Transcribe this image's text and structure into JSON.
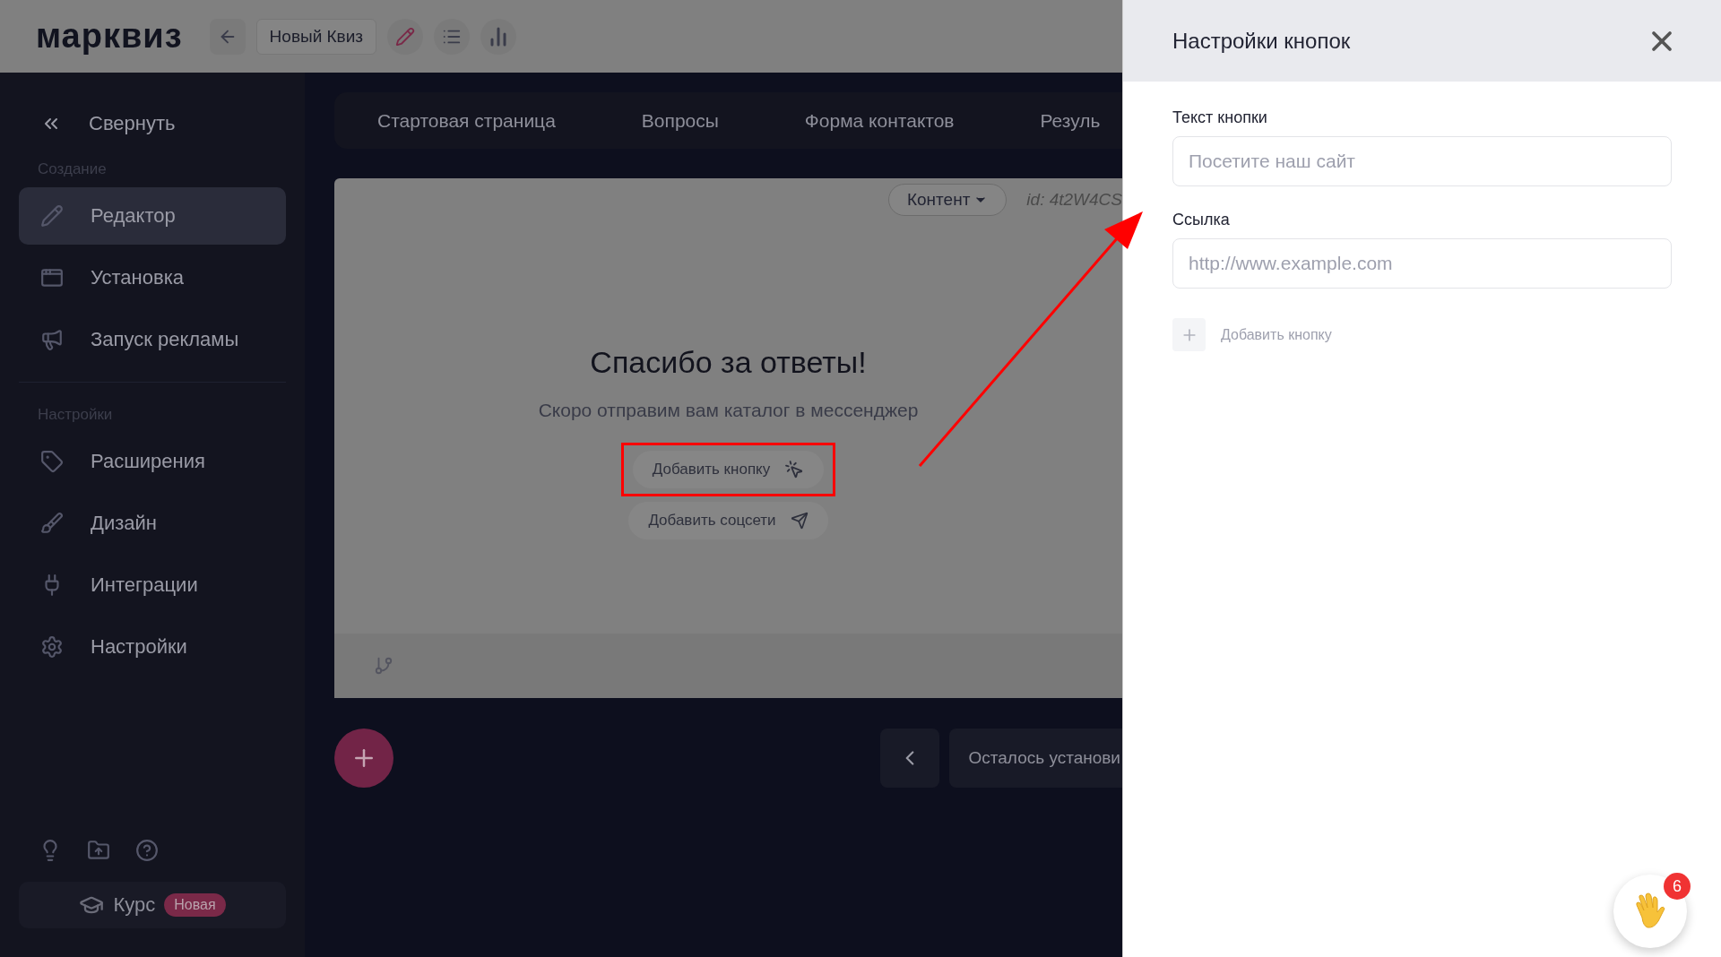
{
  "header": {
    "logo": "марквиз",
    "quiz_name": "Новый Квиз"
  },
  "sidebar": {
    "collapse": "Свернуть",
    "sections": [
      {
        "label": "Создание",
        "items": [
          {
            "label": "Редактор",
            "selected": true
          },
          {
            "label": "Установка",
            "selected": false
          },
          {
            "label": "Запуск рекламы",
            "selected": false
          }
        ]
      },
      {
        "label": "Настройки",
        "items": [
          {
            "label": "Расширения",
            "selected": false
          },
          {
            "label": "Дизайн",
            "selected": false
          },
          {
            "label": "Интеграции",
            "selected": false
          },
          {
            "label": "Настройки",
            "selected": false
          }
        ]
      }
    ],
    "course": {
      "label": "Курс",
      "badge": "Новая"
    }
  },
  "tabs": [
    {
      "label": "Стартовая страница"
    },
    {
      "label": "Вопросы"
    },
    {
      "label": "Форма контактов"
    },
    {
      "label": "Резуль"
    }
  ],
  "card": {
    "content_menu": "Контент",
    "id": "id: 4t2W4CS",
    "title": "Спасибо за ответы!",
    "subtitle": "Скоро отправим вам каталог в мессенджер",
    "add_button": "Добавить кнопку",
    "add_social": "Добавить соцсети"
  },
  "footer": {
    "remaining": "Осталось установи"
  },
  "panel": {
    "title": "Настройки кнопок",
    "fields": [
      {
        "label": "Текст кнопки",
        "placeholder": "Посетите наш сайт"
      },
      {
        "label": "Ссылка",
        "placeholder": "http://www.example.com"
      }
    ],
    "add_button": "Добавить кнопку"
  },
  "chat": {
    "badge": "6"
  }
}
